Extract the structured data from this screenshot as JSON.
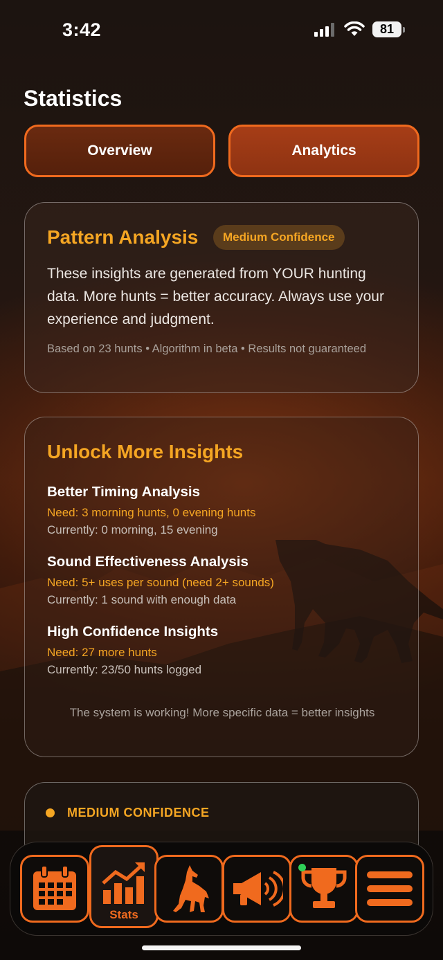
{
  "status_bar": {
    "time": "3:42",
    "battery": "81"
  },
  "page": {
    "title": "Statistics"
  },
  "segments": {
    "overview": "Overview",
    "analytics": "Analytics"
  },
  "pattern_analysis": {
    "title": "Pattern Analysis",
    "badge": "Medium Confidence",
    "body": "These insights are generated from YOUR hunting data. More hunts = better accuracy. Always use your experience and judgment.",
    "footnote": "Based on 23 hunts • Algorithm in beta • Results not guaranteed"
  },
  "unlock": {
    "title": "Unlock More Insights",
    "items": [
      {
        "name": "Better Timing Analysis",
        "need": "Need: 3 morning hunts, 0 evening hunts",
        "current": "Currently: 0 morning, 15 evening"
      },
      {
        "name": "Sound Effectiveness Analysis",
        "need": "Need: 5+ uses per sound (need 2+ sounds)",
        "current": "Currently: 1 sound with enough data"
      },
      {
        "name": "High Confidence Insights",
        "need": "Need: 27 more hunts",
        "current": "Currently: 23/50 hunts logged"
      }
    ],
    "footer": "The system is working! More specific data = better insights"
  },
  "confidence_card": {
    "label": "MEDIUM CONFIDENCE"
  },
  "tabbar": {
    "stats_label": "Stats"
  },
  "colors": {
    "accent": "#f06a1e",
    "highlight": "#f5a623",
    "background": "#130d0a"
  }
}
